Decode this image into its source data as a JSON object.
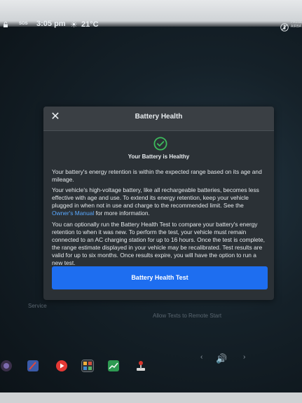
{
  "status_bar": {
    "sos_label": "SOS",
    "time": "3:05 pm",
    "temperature": "21°C",
    "airbag_text": "PASSE\nAIRBA"
  },
  "modal": {
    "title": "Battery Health",
    "healthy_title": "Your Battery is Healthy",
    "paragraph1": "Your battery's energy retention is within the expected range based on its age and mileage.",
    "paragraph2_before_link": "Your vehicle's high-voltage battery, like all rechargeable batteries, becomes less effective with age and use. To extend its energy retention, keep your vehicle plugged in when not in use and charge to the recommended limit. See the ",
    "paragraph2_link": "Owner's Manual",
    "paragraph2_after_link": " for more information.",
    "paragraph3": "You can optionally run the Battery Health Test to compare your battery's energy retention to when it was new. To perform the test, your vehicle must remain connected to an AC charging station for up to 16 hours. Once the test is complete, the range estimate displayed in your vehicle may be recalibrated. Test results are valid for up to six months. Once results expire, you will have the option to run a new test.",
    "button_label": "Battery Health Test",
    "close_glyph": "✕",
    "check_color": "#3dbb5c"
  },
  "background": {
    "left_label": "Service",
    "right_label": "Allow Texts to Remote Start"
  },
  "dock": {
    "icons": [
      "camera-icon",
      "navigation-icon",
      "media-player-icon",
      "apps-icon",
      "charts-icon",
      "joystick-icon"
    ],
    "volume_glyph": "🔊",
    "chevron_left": "‹",
    "chevron_right": "›"
  },
  "colors": {
    "accent_blue": "#1e6ef0",
    "link_blue": "#5aa9ff",
    "success_green": "#3dbb5c"
  }
}
